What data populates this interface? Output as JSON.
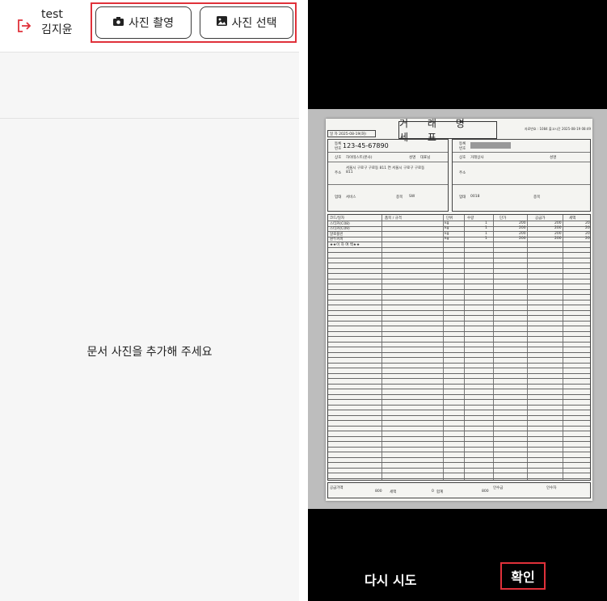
{
  "header": {
    "user_id": "test",
    "user_name": "김지윤",
    "take_photo_label": "사진 촬영",
    "select_photo_label": "사진 선택"
  },
  "main": {
    "empty_message": "문서 사진을 추가해 주세요"
  },
  "preview": {
    "document": {
      "title": "거 래 명 세 표",
      "serial_text": "자료번호 : 1084  출고시간 2025-08-19 08:49",
      "date_label": "일 자",
      "date_value": "2025-08-19(화)",
      "supplier": {
        "reg_no_label": "등록번호",
        "reg_no": "123-45-67890",
        "name_label": "상호",
        "name": "하이테스트(본사)",
        "rep_label": "성명",
        "rep": "대표님",
        "address_label": "주소",
        "address": "서울시 구로구 구로동 811 연 서울시 구로구 구로동 811",
        "business_label": "업태",
        "business": "서비스",
        "item_label": "종목",
        "item": "SW"
      },
      "buyer": {
        "reg_no_label": "등록번호",
        "name_label": "상호",
        "name": "거래상사",
        "rep_label": "성명",
        "address_label": "주소",
        "business_label": "업태",
        "business": "0018",
        "item_label": "종목"
      },
      "columns": [
        "코드/일자",
        "품목 / 규격",
        "단위",
        "수량",
        "단가",
        "공급가",
        "세액"
      ],
      "rows": [
        [
          "스티커(C08)",
          "",
          "kg",
          "1",
          "200",
          "200",
          "20"
        ],
        [
          "스티커(C09)",
          "",
          "kg",
          "1",
          "200",
          "200",
          "20"
        ],
        [
          "알로플빈",
          "",
          "kg",
          "1",
          "200",
          "200",
          "20"
        ],
        [
          "원두커피",
          "",
          "kg",
          "1",
          "200",
          "200",
          "20"
        ],
        [
          "★★이 하 여 백★★",
          "",
          "",
          "",
          "",
          "",
          ""
        ]
      ],
      "totals": {
        "supply_label": "공급가액",
        "supply": "800",
        "tax_label": "세액",
        "tax": "0",
        "total_label": "합계",
        "total": "800",
        "received_label": "인수금",
        "receiver_label": "인수자"
      }
    },
    "retry_label": "다시 시도",
    "confirm_label": "확인"
  }
}
